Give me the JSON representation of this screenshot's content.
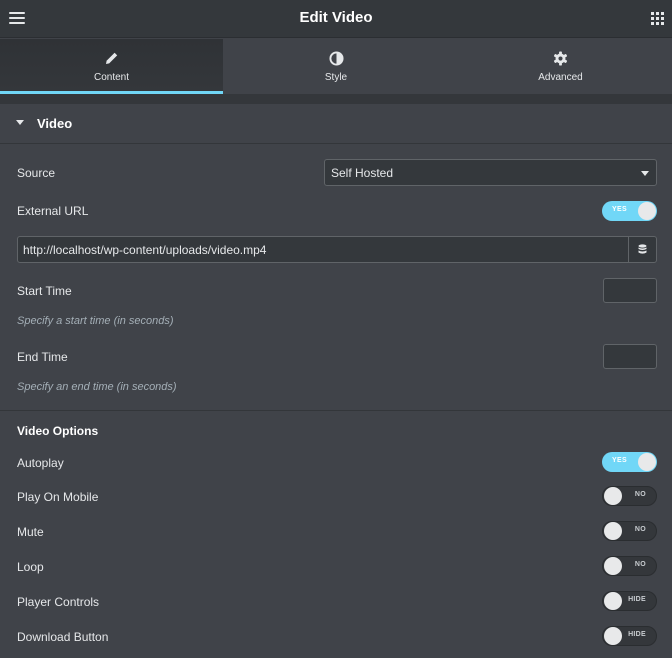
{
  "header": {
    "title": "Edit Video",
    "menu_icon": "hamburger-icon",
    "apps_icon": "grid-icon"
  },
  "tabs": [
    {
      "label": "Content",
      "icon": "pencil-icon",
      "active": true
    },
    {
      "label": "Style",
      "icon": "contrast-icon",
      "active": false
    },
    {
      "label": "Advanced",
      "icon": "gear-icon",
      "active": false
    }
  ],
  "section": {
    "title": "Video",
    "expanded": true
  },
  "source": {
    "label": "Source",
    "value": "Self Hosted"
  },
  "external_url": {
    "label": "External URL",
    "state": "YES"
  },
  "url_field": {
    "value": "http://localhost/wp-content/uploads/video.mp4",
    "icon": "database-icon"
  },
  "start_time": {
    "label": "Start Time",
    "value": "",
    "hint": "Specify a start time (in seconds)"
  },
  "end_time": {
    "label": "End Time",
    "value": "",
    "hint": "Specify an end time (in seconds)"
  },
  "video_options": {
    "title": "Video Options",
    "items": [
      {
        "label": "Autoplay",
        "state": "YES"
      },
      {
        "label": "Play On Mobile",
        "state": "NO"
      },
      {
        "label": "Mute",
        "state": "NO"
      },
      {
        "label": "Loop",
        "state": "NO"
      },
      {
        "label": "Player Controls",
        "state": "HIDE"
      },
      {
        "label": "Download Button",
        "state": "HIDE"
      }
    ]
  },
  "colors": {
    "accent": "#71d7f7",
    "panel": "#404349",
    "header": "#34383c"
  }
}
